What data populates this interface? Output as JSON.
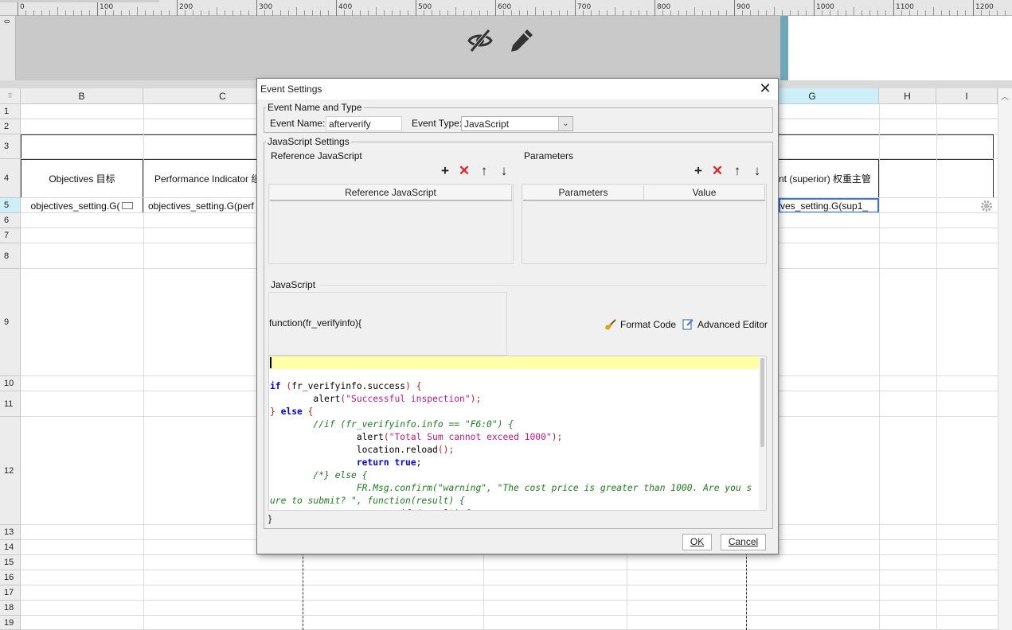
{
  "ruler": {
    "labels": [
      "0",
      "100",
      "200",
      "300",
      "400",
      "500",
      "600",
      "700",
      "800",
      "900",
      "1000",
      "1100",
      "1200"
    ],
    "vertical_label": "0"
  },
  "header_band": {
    "icons": [
      "eye-slash-icon",
      "pencil-icon"
    ]
  },
  "sheet": {
    "corner": "⠿",
    "columns": [
      "B",
      "C",
      "G",
      "H",
      "I"
    ],
    "selected_column": "G",
    "rows": [
      "1",
      "2",
      "3",
      "4",
      "5",
      "6",
      "7",
      "8",
      "9",
      "10",
      "11",
      "12",
      "13",
      "14",
      "15",
      "16",
      "17",
      "18",
      "19"
    ],
    "selected_row": "5",
    "cells": {
      "b4": "Objectives 目标",
      "c4": "Performance Indicator 绩",
      "g4": "nt (superior) 权重主管",
      "b5": "objectives_setting.G(",
      "c5": "objectives_setting.G(perf",
      "g5": "ves_setting.G(sup1_"
    }
  },
  "dialog": {
    "title": "Event Settings",
    "group_name_type": "Event Name and Type",
    "event_name_label": "Event Name:",
    "event_name_value": "afterverify",
    "event_type_label": "Event Type:",
    "event_type_value": "JavaScript",
    "group_js_settings": "JavaScript Settings",
    "ref_js_title": "Reference JavaScript",
    "ref_js_column": "Reference JavaScript",
    "params_title": "Parameters",
    "params_columns": [
      "Parameters",
      "Value"
    ],
    "javascript_label": "JavaScript",
    "function_signature": "function(fr_verifyinfo){",
    "format_code": "Format Code",
    "advanced_editor": "Advanced Editor",
    "closing_brace": "}",
    "ok": "OK",
    "cancel": "Cancel",
    "code_lines": [
      "",
      "if (fr_verifyinfo.success) {",
      "        alert(\"Successful inspection\");",
      "} else {",
      "        //if (fr_verifyinfo.info == \"F6:0\") {",
      "                alert(\"Total Sum cannot exceed 1000\");",
      "                location.reload();",
      "                return true;",
      "        /*} else {",
      "                FR.Msg.confirm(\"warning\", \"The cost price is greater than 1000. Are you s",
      "ure to submit? \", function(result) {",
      "                        if (result) {"
    ]
  }
}
